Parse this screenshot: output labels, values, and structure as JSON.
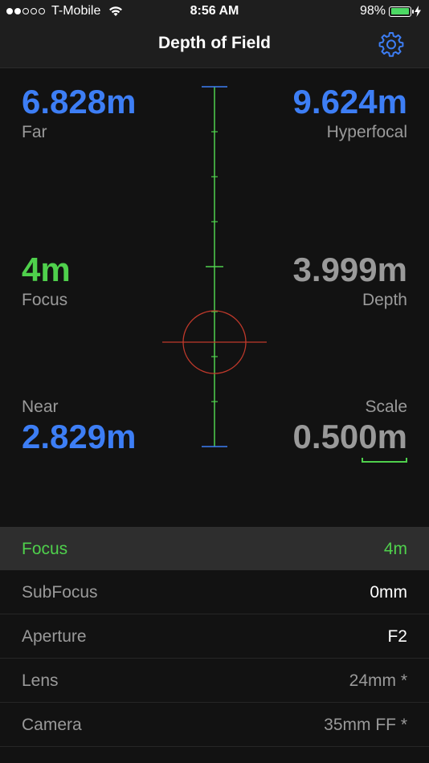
{
  "status_bar": {
    "carrier": "T-Mobile",
    "time": "8:56 AM",
    "battery_percent": "98%",
    "battery_level": 0.98,
    "signal_bars_filled": 2,
    "signal_bars_total": 5
  },
  "nav": {
    "title": "Depth of Field",
    "settings_icon": "gear-icon"
  },
  "readouts": {
    "far": {
      "value": "6.828m",
      "label": "Far"
    },
    "hyperfocal": {
      "value": "9.624m",
      "label": "Hyperfocal"
    },
    "focus": {
      "value": "4m",
      "label": "Focus"
    },
    "depth": {
      "value": "3.999m",
      "label": "Depth"
    },
    "near": {
      "value": "2.829m",
      "label": "Near"
    },
    "scale": {
      "value": "0.500m",
      "label": "Scale"
    }
  },
  "colors": {
    "accent_blue": "#3d7ef5",
    "accent_green": "#4fd04c",
    "crosshair_red": "#c0392b",
    "background": "#121212"
  },
  "settings": [
    {
      "label": "Focus",
      "value": "4m",
      "active": true
    },
    {
      "label": "SubFocus",
      "value": "0mm"
    },
    {
      "label": "Aperture",
      "value": "F2"
    },
    {
      "label": "Lens",
      "value": "24mm *"
    },
    {
      "label": "Camera",
      "value": "35mm FF *"
    }
  ]
}
